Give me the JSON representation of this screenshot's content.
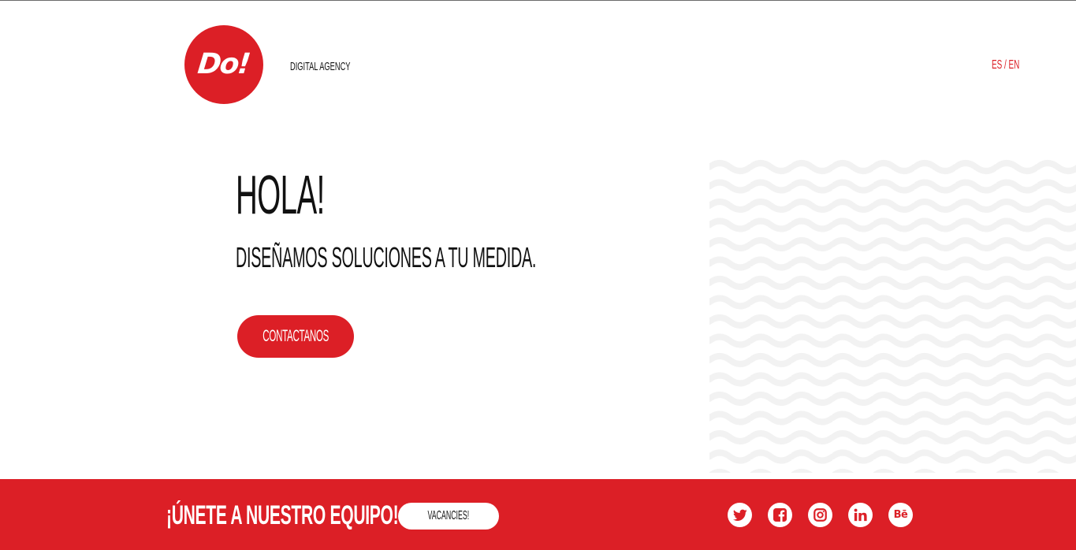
{
  "header": {
    "logo_text": "Do!",
    "tagline": "DIGITAL AGENCY",
    "lang_es": "ES",
    "lang_sep": "/",
    "lang_en": "EN"
  },
  "hero": {
    "title": "HOLA!",
    "subtitle": "DISEÑAMOS SOLUCIONES A TU MEDIDA.",
    "cta_label": "CONTACTANOS"
  },
  "footer": {
    "join_text": "¡ÚNETE A NUESTRO EQUIPO!",
    "vacancies_label": "VACANCIES!",
    "social": [
      {
        "name": "twitter-icon"
      },
      {
        "name": "facebook-icon"
      },
      {
        "name": "instagram-icon"
      },
      {
        "name": "linkedin-icon"
      },
      {
        "name": "behance-icon",
        "glyph": "Bē"
      }
    ]
  },
  "colors": {
    "brand_red": "#dc1f26",
    "text_dark": "#111111",
    "wave_pattern": "#f2f2f2"
  }
}
